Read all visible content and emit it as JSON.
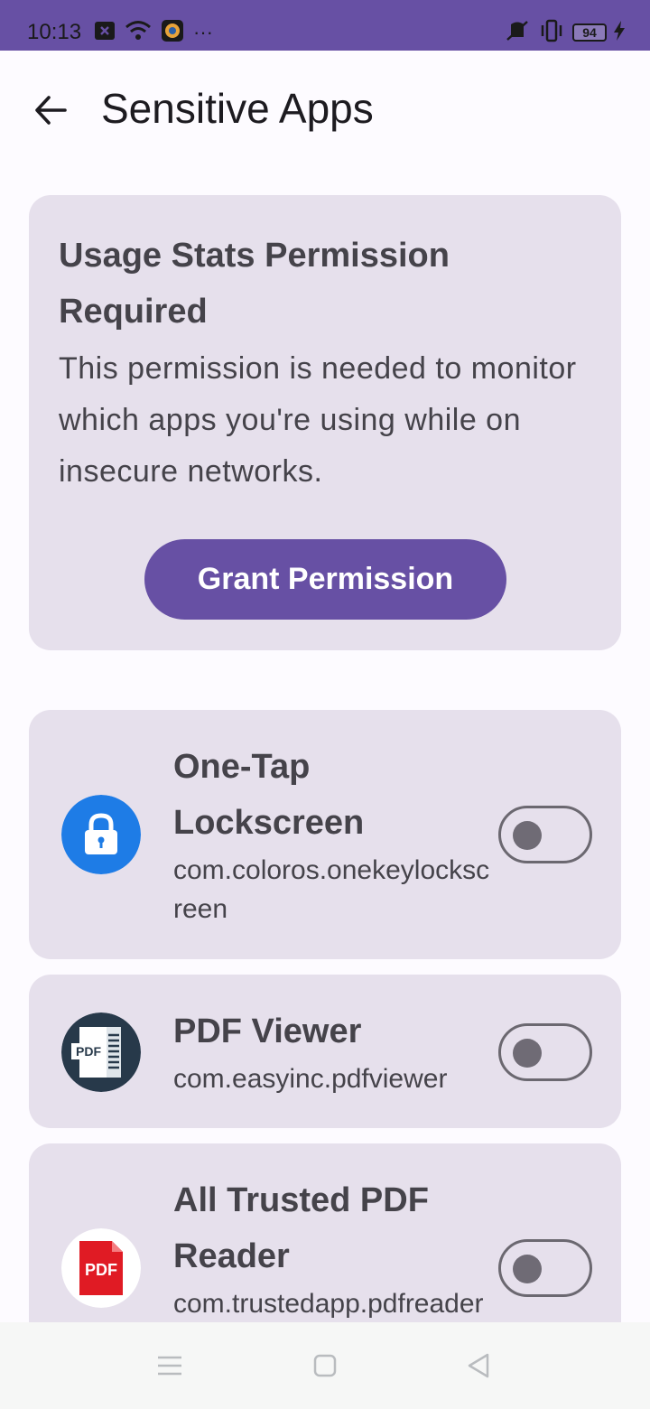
{
  "status_bar": {
    "time": "10:13",
    "more": "···",
    "battery": "94"
  },
  "header": {
    "title": "Sensitive Apps",
    "back_icon": "arrow-left-icon"
  },
  "permission_card": {
    "title": "Usage Stats Permission Required",
    "text": "This permission is needed to monitor which apps you're using while on insecure networks.",
    "button_label": "Grant Permission"
  },
  "apps": [
    {
      "name": "One-Tap Lockscreen",
      "package": "com.coloros.onekeylockscreen",
      "icon": "lock-icon",
      "enabled": false
    },
    {
      "name": "PDF Viewer",
      "package": "com.easyinc.pdfviewer",
      "icon": "pdf-document-icon",
      "enabled": false
    },
    {
      "name": "All Trusted PDF Reader",
      "package": "com.trustedapp.pdfreader",
      "icon": "pdf-file-icon",
      "enabled": false
    }
  ],
  "icons": {
    "pdf_badge": "PDF"
  },
  "colors": {
    "primary": "#6750a4",
    "card_bg": "#e6e0ec",
    "text": "#45434a"
  }
}
